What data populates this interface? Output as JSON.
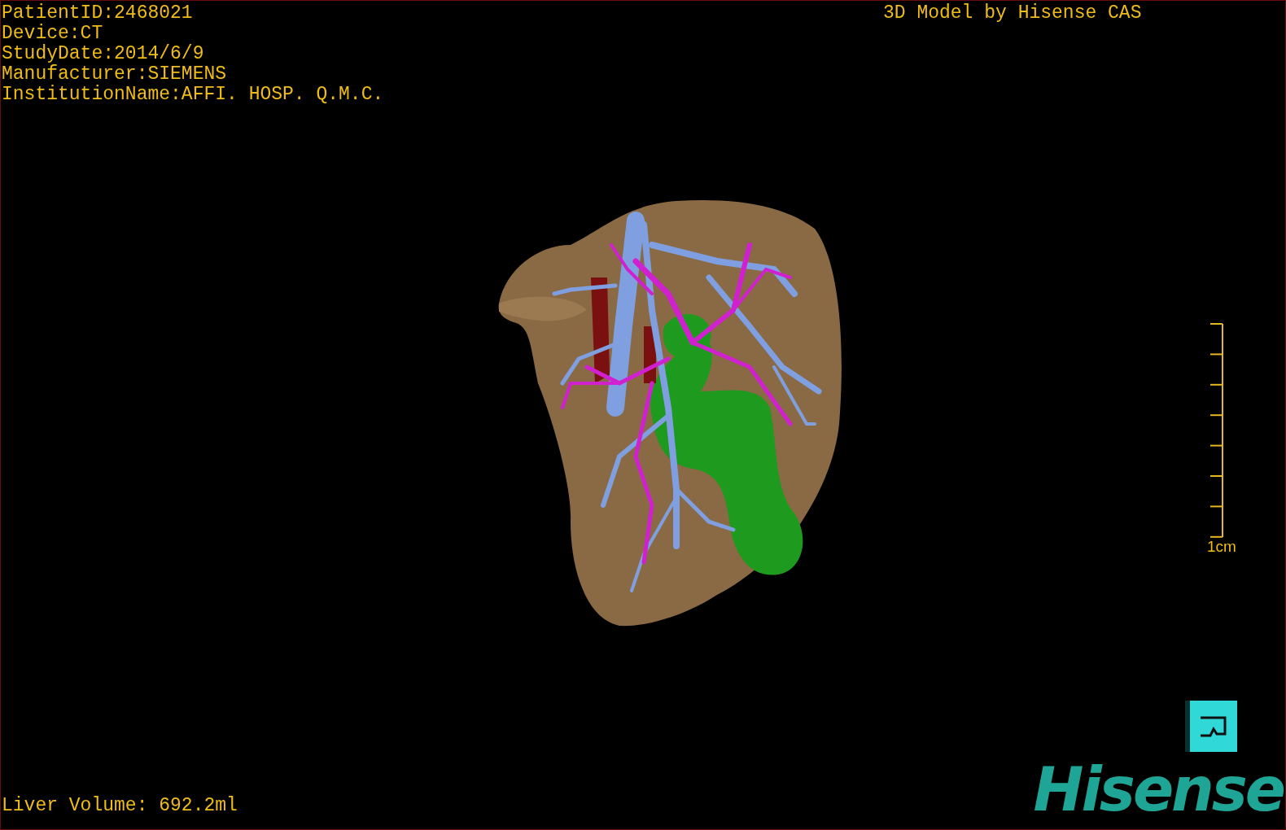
{
  "patient_info": [
    "PatientID:2468021",
    "Device:CT",
    "StudyDate:2014/6/9",
    "Manufacturer:SIEMENS",
    "InstitutionName:AFFI. HOSP. Q.M.C."
  ],
  "title": "3D Model by Hisense CAS",
  "scale_bar": {
    "label": "1cm"
  },
  "liver_volume": "Liver Volume: 692.2ml",
  "logo": {
    "text": "Hisense"
  }
}
